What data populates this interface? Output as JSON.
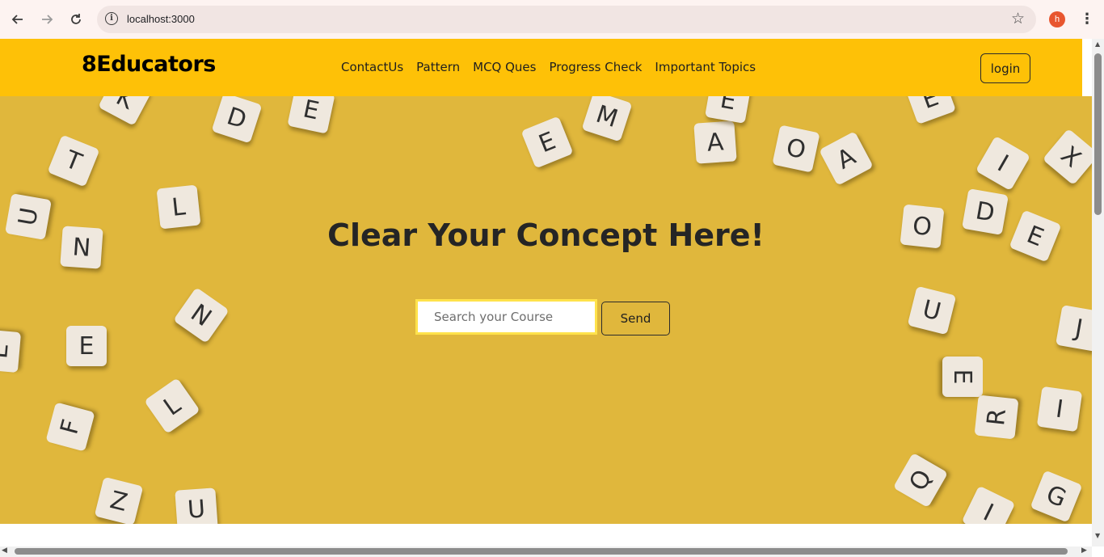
{
  "browser": {
    "back_icon": "arrow-left-icon",
    "forward_icon": "arrow-right-icon",
    "reload_icon": "reload-icon",
    "info_icon": "info-icon",
    "info_glyph": "i",
    "url": "localhost:3000",
    "bookmark_icon": "star-icon",
    "profile_initial": "h",
    "menu_icon": "kebab-menu-icon"
  },
  "header": {
    "brand": "8Educators",
    "nav": [
      "ContactUs",
      "Pattern",
      "MCQ Ques",
      "Progress Check",
      "Important Topics"
    ],
    "login_label": "login",
    "background_color": "#fec107"
  },
  "hero": {
    "title": "Clear Your Concept Here!",
    "search_placeholder": "Search your Course",
    "search_value": "",
    "send_label": "Send",
    "background_color": "#e0b73c",
    "tiles": [
      "K",
      "D",
      "E",
      "T",
      "L",
      "U",
      "N",
      "N",
      "E",
      "E",
      "F",
      "L",
      "Z",
      "U",
      "M",
      "E",
      "A",
      "O",
      "A",
      "X",
      "I",
      "O",
      "D",
      "E",
      "U",
      "J",
      "E",
      "I",
      "R",
      "Q",
      "G",
      "I",
      "E",
      "E"
    ]
  }
}
